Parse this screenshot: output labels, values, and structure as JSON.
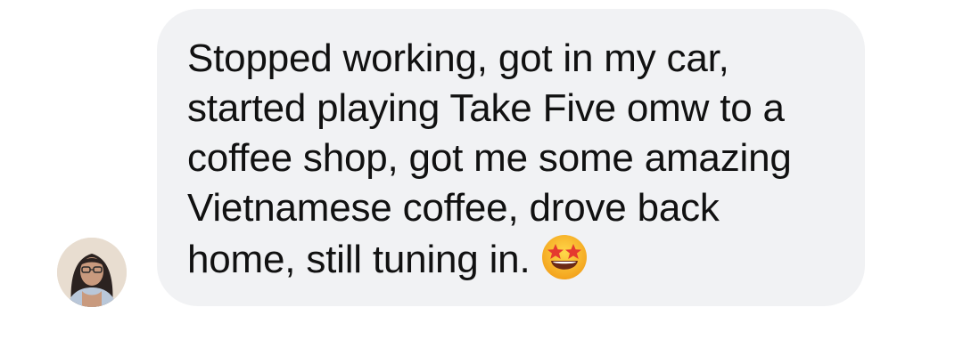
{
  "message": {
    "lines": [
      "Stopped working, got in my car,",
      "started playing Take Five omw to a",
      "coffee shop, got me some amazing",
      "Vietnamese coffee, drove back",
      "home, still tuning in."
    ],
    "emoji": "star-struck-emoji",
    "bubble_color": "#f1f2f4",
    "text_color": "#111111"
  },
  "sender": {
    "avatar_icon": "profile-photo"
  }
}
